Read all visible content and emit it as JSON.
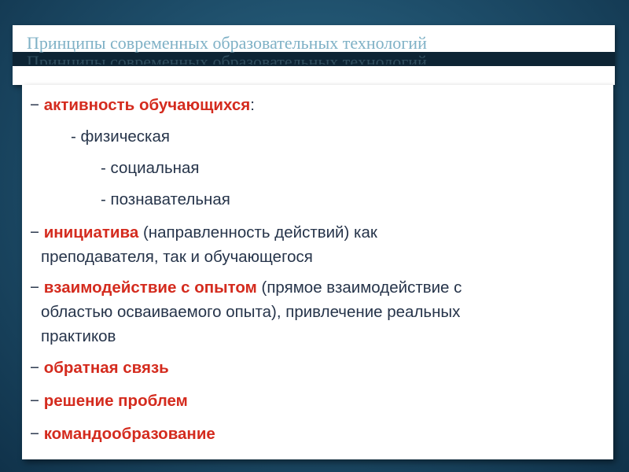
{
  "slide": {
    "title": "Принципы современных образовательных технологий",
    "dash": "−",
    "items": [
      {
        "strong": "активность обучающихся",
        "rest": ":"
      },
      {
        "text": "- физическая"
      },
      {
        "text": "- социальная"
      },
      {
        "text": "- познавательная"
      },
      {
        "strong": "инициатива",
        "line1": " (направленность действий) как",
        "line2": "преподавателя, так и обучающегося"
      },
      {
        "strong": "взаимодействие с опытом",
        "line1": " (прямое взаимодействие с",
        "line2": "областью осваиваемого опыта), привлечение реальных",
        "line3": "практиков"
      },
      {
        "strong": "обратная связь"
      },
      {
        "strong": "решение проблем"
      },
      {
        "strong": "командообразование"
      }
    ]
  },
  "colors": {
    "accent": "#d42b1e",
    "title_text": "#7fb1c6",
    "background": "#1d4c68",
    "body_text": "#26344a"
  }
}
